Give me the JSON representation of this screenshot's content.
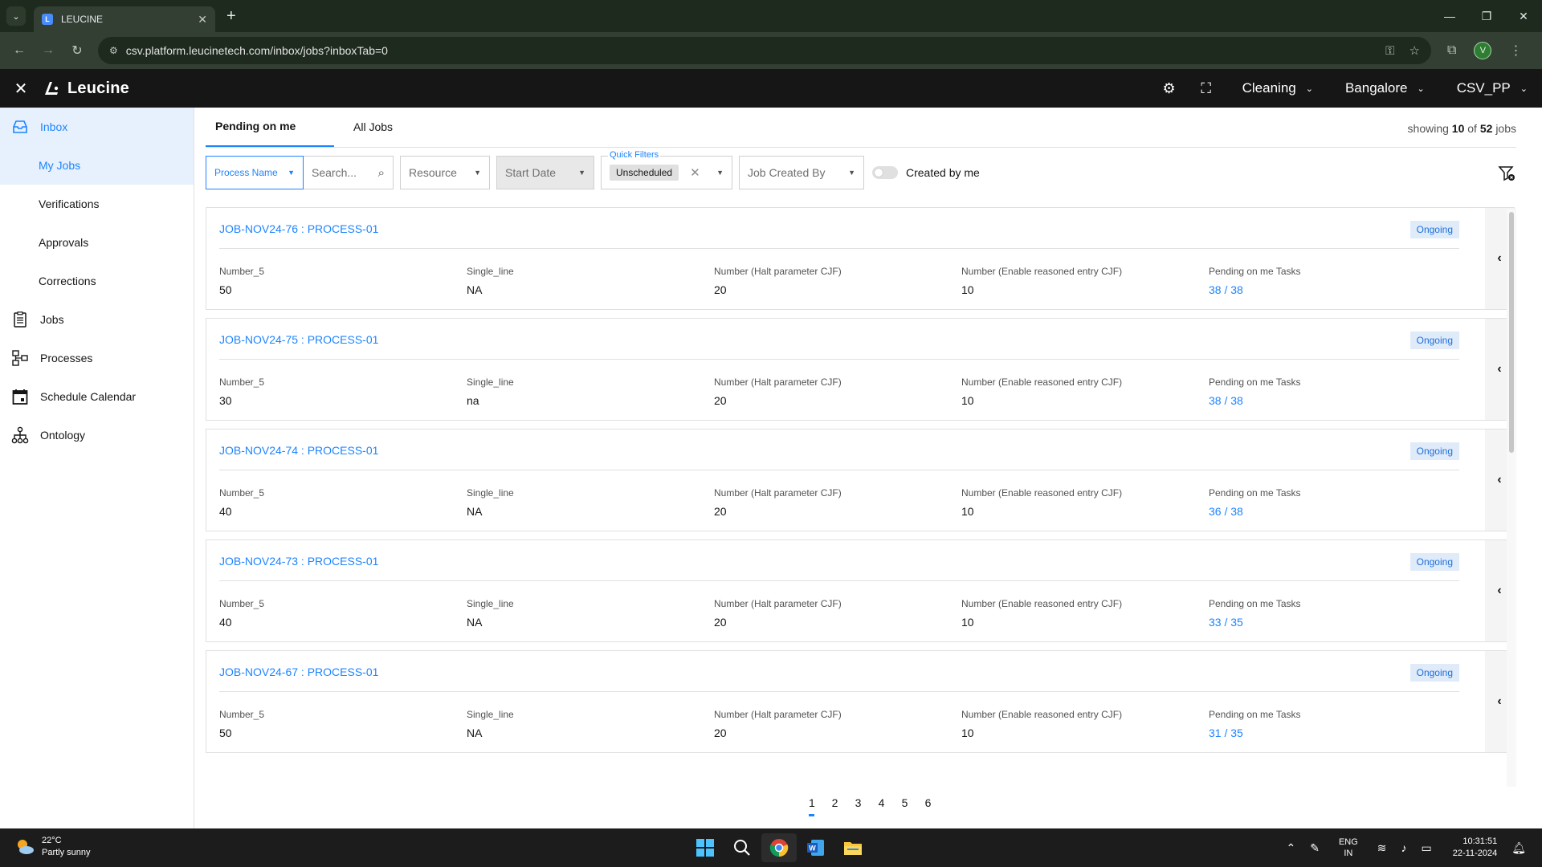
{
  "browser": {
    "tab_title": "LEUCINE",
    "url": "csv.platform.leucinetech.com/inbox/jobs?inboxTab=0",
    "profile_initial": "V"
  },
  "app": {
    "brand": "Leucine",
    "use_case": "Cleaning",
    "facility": "Bangalore",
    "account": "CSV_PP"
  },
  "sidebar": {
    "items": [
      {
        "label": "Inbox",
        "icon": "inbox-icon"
      },
      {
        "label": "My Jobs"
      },
      {
        "label": "Verifications"
      },
      {
        "label": "Approvals"
      },
      {
        "label": "Corrections"
      },
      {
        "label": "Jobs",
        "icon": "clipboard-icon"
      },
      {
        "label": "Processes",
        "icon": "processes-icon"
      },
      {
        "label": "Schedule Calendar",
        "icon": "calendar-icon"
      },
      {
        "label": "Ontology",
        "icon": "ontology-icon"
      }
    ]
  },
  "tabs": {
    "pending": "Pending on me",
    "all": "All Jobs"
  },
  "showing": {
    "prefix": "showing",
    "count": "10",
    "of": "of",
    "total": "52",
    "suffix": "jobs"
  },
  "filters": {
    "process_name": "Process Name",
    "search_placeholder": "Search...",
    "resource": "Resource",
    "start_date": "Start Date",
    "quick_filters_label": "Quick Filters",
    "quick_filter_chip": "Unscheduled",
    "job_created_by": "Job Created By",
    "created_by_me": "Created by me"
  },
  "columns": {
    "c1": "Number_5",
    "c2": "Single_line",
    "c3": "Number (Halt parameter CJF)",
    "c4": "Number (Enable reasoned entry CJF)",
    "c5": "Pending on me Tasks"
  },
  "jobs": [
    {
      "title": "JOB-NOV24-76 : PROCESS-01",
      "status": "Ongoing",
      "v1": "50",
      "v2": "NA",
      "v3": "20",
      "v4": "10",
      "v5": "38 / 38"
    },
    {
      "title": "JOB-NOV24-75 : PROCESS-01",
      "status": "Ongoing",
      "v1": "30",
      "v2": "na",
      "v3": "20",
      "v4": "10",
      "v5": "38 / 38"
    },
    {
      "title": "JOB-NOV24-74 : PROCESS-01",
      "status": "Ongoing",
      "v1": "40",
      "v2": "NA",
      "v3": "20",
      "v4": "10",
      "v5": "36 / 38"
    },
    {
      "title": "JOB-NOV24-73 : PROCESS-01",
      "status": "Ongoing",
      "v1": "40",
      "v2": "NA",
      "v3": "20",
      "v4": "10",
      "v5": "33 / 35"
    },
    {
      "title": "JOB-NOV24-67 : PROCESS-01",
      "status": "Ongoing",
      "v1": "50",
      "v2": "NA",
      "v3": "20",
      "v4": "10",
      "v5": "31 / 35"
    }
  ],
  "pagination": {
    "pages": [
      "1",
      "2",
      "3",
      "4",
      "5",
      "6"
    ],
    "current": "1"
  },
  "taskbar": {
    "temp": "22°C",
    "weather": "Partly sunny",
    "lang1": "ENG",
    "lang2": "IN",
    "time": "10:31:51",
    "date": "22-11-2024"
  },
  "colors": {
    "accent": "#1d84ff",
    "header_bg": "#161616",
    "badge_bg": "#e0ebfa"
  }
}
